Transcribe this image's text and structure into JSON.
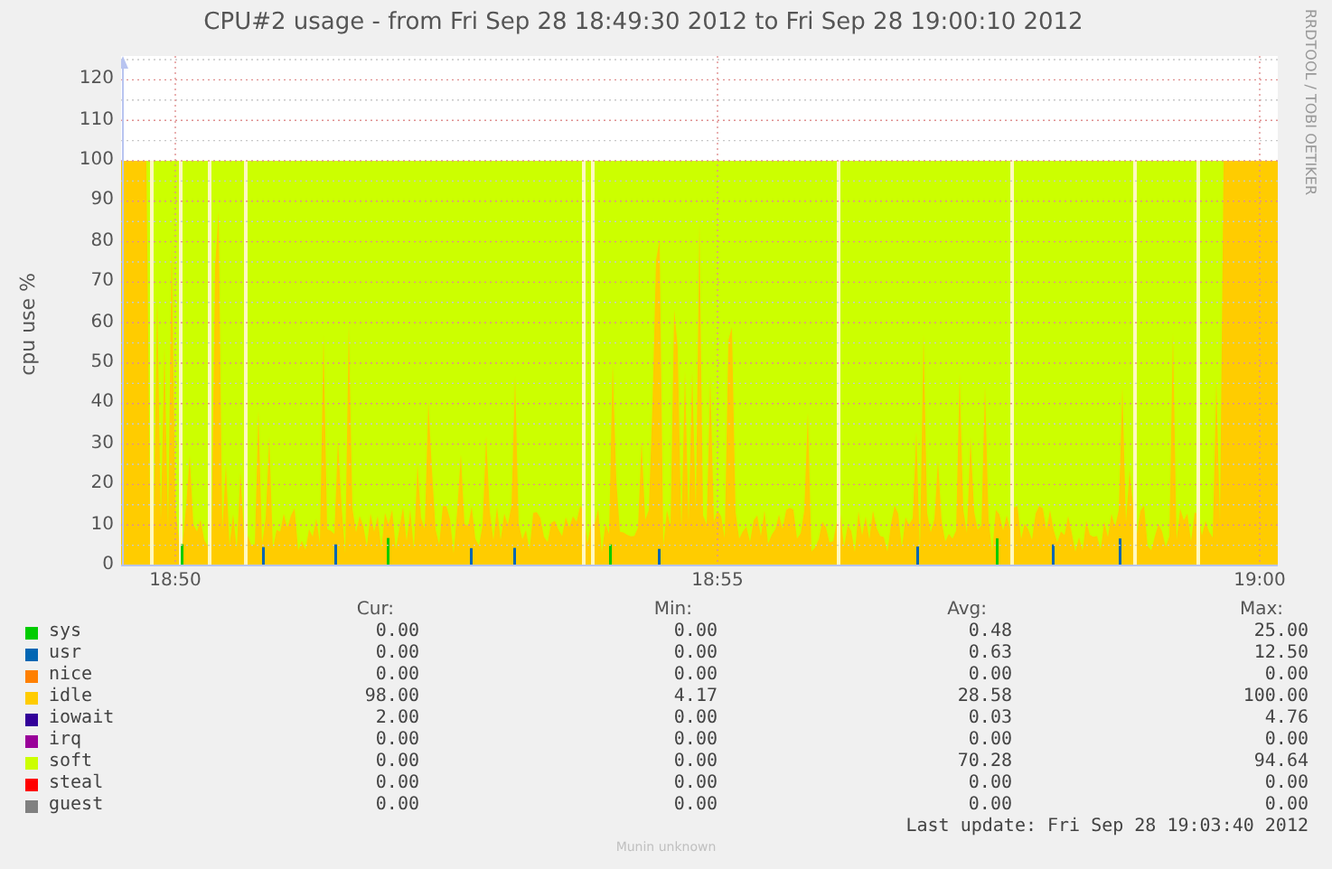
{
  "title": "CPU#2 usage - from Fri Sep 28 18:49:30 2012 to Fri Sep 28 19:00:10 2012",
  "credit": "RRDTOOL / TOBI OETIKER",
  "y_axis": {
    "label": "cpu use %",
    "ticks": [
      "120",
      "110",
      "100",
      "90",
      "80",
      "70",
      "60",
      "50",
      "40",
      "30",
      "20",
      "10",
      "0"
    ]
  },
  "x_axis": {
    "ticks": [
      "18:50",
      "18:55",
      "19:00"
    ]
  },
  "legend": {
    "columns": [
      "Cur:",
      "Min:",
      "Avg:",
      "Max:"
    ],
    "rows": [
      {
        "name": "sys",
        "color": "#00cc00",
        "values": [
          "0.00",
          "0.00",
          "0.48",
          "25.00"
        ]
      },
      {
        "name": "usr",
        "color": "#0066b3",
        "values": [
          "0.00",
          "0.00",
          "0.63",
          "12.50"
        ]
      },
      {
        "name": "nice",
        "color": "#ff8000",
        "values": [
          "0.00",
          "0.00",
          "0.00",
          "0.00"
        ]
      },
      {
        "name": "idle",
        "color": "#ffcc00",
        "values": [
          "98.00",
          "4.17",
          "28.58",
          "100.00"
        ]
      },
      {
        "name": "iowait",
        "color": "#330099",
        "values": [
          "2.00",
          "0.00",
          "0.03",
          "4.76"
        ]
      },
      {
        "name": "irq",
        "color": "#990099",
        "values": [
          "0.00",
          "0.00",
          "0.00",
          "0.00"
        ]
      },
      {
        "name": "soft",
        "color": "#ccff00",
        "values": [
          "0.00",
          "0.00",
          "70.28",
          "94.64"
        ]
      },
      {
        "name": "steal",
        "color": "#ff0000",
        "values": [
          "0.00",
          "0.00",
          "0.00",
          "0.00"
        ]
      },
      {
        "name": "guest",
        "color": "#808080",
        "values": [
          "0.00",
          "0.00",
          "0.00",
          "0.00"
        ]
      }
    ]
  },
  "last_update": "Last update: Fri Sep 28 19:03:40 2012",
  "footer": "Munin unknown"
}
